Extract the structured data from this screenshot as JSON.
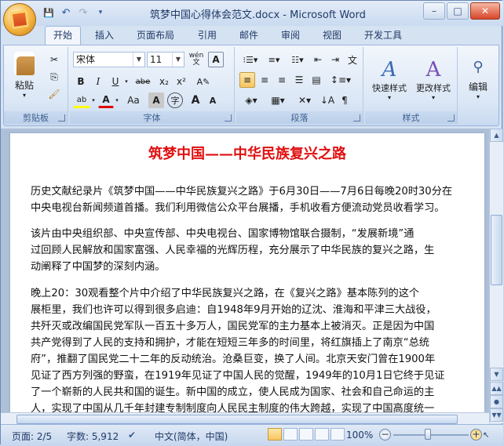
{
  "window": {
    "title": "筑梦中国心得体会范文.docx - Microsoft Word",
    "controls": [
      "–",
      "□",
      "✕"
    ]
  },
  "qat": {
    "save": "💾",
    "undo": "↶",
    "redo": "↷",
    "more": "▾"
  },
  "tabs": [
    "开始",
    "插入",
    "页面布局",
    "引用",
    "邮件",
    "审阅",
    "视图",
    "开发工具"
  ],
  "ribbon": {
    "clipboard": {
      "label": "剪贴板",
      "paste": "粘贴"
    },
    "font": {
      "label": "字体",
      "font_name": "宋体",
      "font_size": "11",
      "wen": "wén\n文",
      "A_box": "A",
      "bold": "B",
      "italic": "I",
      "underline": "U",
      "strike": "abe",
      "sub": "x₂",
      "sup": "x²",
      "highlight": "ab",
      "color": "A",
      "case": "Aa",
      "shade": "A",
      "enclose": "字",
      "grow": "A",
      "shrink": "A"
    },
    "paragraph": {
      "label": "段落"
    },
    "styles": {
      "label": "样式",
      "quick_styles": "快速样式",
      "change_styles": "更改样式"
    },
    "editing": {
      "label": "编辑"
    }
  },
  "document": {
    "title": "筑梦中国——中华民族复兴之路",
    "p1": [
      "历史文献纪录片《筑梦中国——中华民族复兴之路》于6月30日——7月6日每晚20时30分在",
      "中央电视台新闻频道首播。我们利用微信公众平台展播，手机收看方便流动党员收看学习。"
    ],
    "p2": [
      "      该片由中央组织部、中央宣传部、中央电视台、国家博物馆联合摄制，“发展新境”通",
      "过回顾人民解放和国家富强、人民幸福的光辉历程，充分展示了中华民族的复兴之路，生",
      "动阐释了中国梦的深刻内涵。"
    ],
    "p3": [
      "      晚上20：30观看整个片中介绍了中华民族复兴之路，在《复兴之路》基本陈列的这个",
      "展柜里，我们也许可以得到很多启迪：自1948年9月开始的辽沈、淮海和平津三大战役，",
      "共歼灭或改编国民党军队一百五十多万人，国民党军的主力基本上被消灭。正是因为中国",
      "共产党得到了人民的支持和拥护，才能在短短三年多的时间里，将红旗插上了南京“总统",
      "府”，推翻了国民党二十二年的反动统治。沧桑巨变，换了人间。北京天安门曾在1900年",
      "见证了西方列强的野蛮，在1919年见证了中国人民的觉醒，1949年的10月1日它终于见证",
      "了一个崭新的人民共和国的诞生。新中国的成立，使人民成为国家、社会和自己命运的主",
      "人，实现了中国从几千年封建专制制度向人民民主制度的伟大跨越，实现了中国高度统一"
    ]
  },
  "status": {
    "page": "页面: 2/5",
    "words": "字数: 5,912",
    "language": "中文(简体，中国)",
    "zoom": "100%",
    "zoom_level_percent": 100
  }
}
